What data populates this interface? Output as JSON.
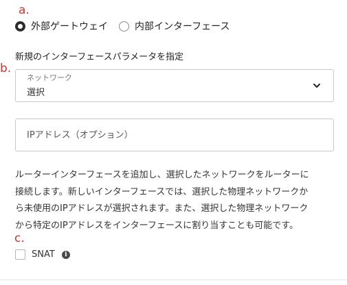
{
  "annotations": {
    "a": "a.",
    "b": "b.",
    "c": "c."
  },
  "gateway_type": {
    "options": [
      {
        "label": "外部ゲートウェイ",
        "selected": true
      },
      {
        "label": "内部インターフェース",
        "selected": false
      }
    ]
  },
  "section_label": "新規のインターフェースパラメータを指定",
  "network_select": {
    "label": "ネットワーク",
    "value": "選択"
  },
  "ip_input": {
    "placeholder": "IPアドレス（オプション）",
    "value": ""
  },
  "description": [
    "ルーターインターフェースを追加し、選択したネットワークをルーターに",
    "接続します。新しいインターフェースでは、選択した物理ネットワークか",
    "ら未使用のIPアドレスが選択されます。また、選択した物理ネットワーク",
    "から特定のIPアドレスをインターフェースに割り当すことも可能です。"
  ],
  "snat": {
    "label": "SNAT",
    "checked": false,
    "info_icon": "info-icon"
  },
  "colors": {
    "annotation": "#d0312d",
    "border": "#c9c9c9",
    "text": "#333333"
  }
}
